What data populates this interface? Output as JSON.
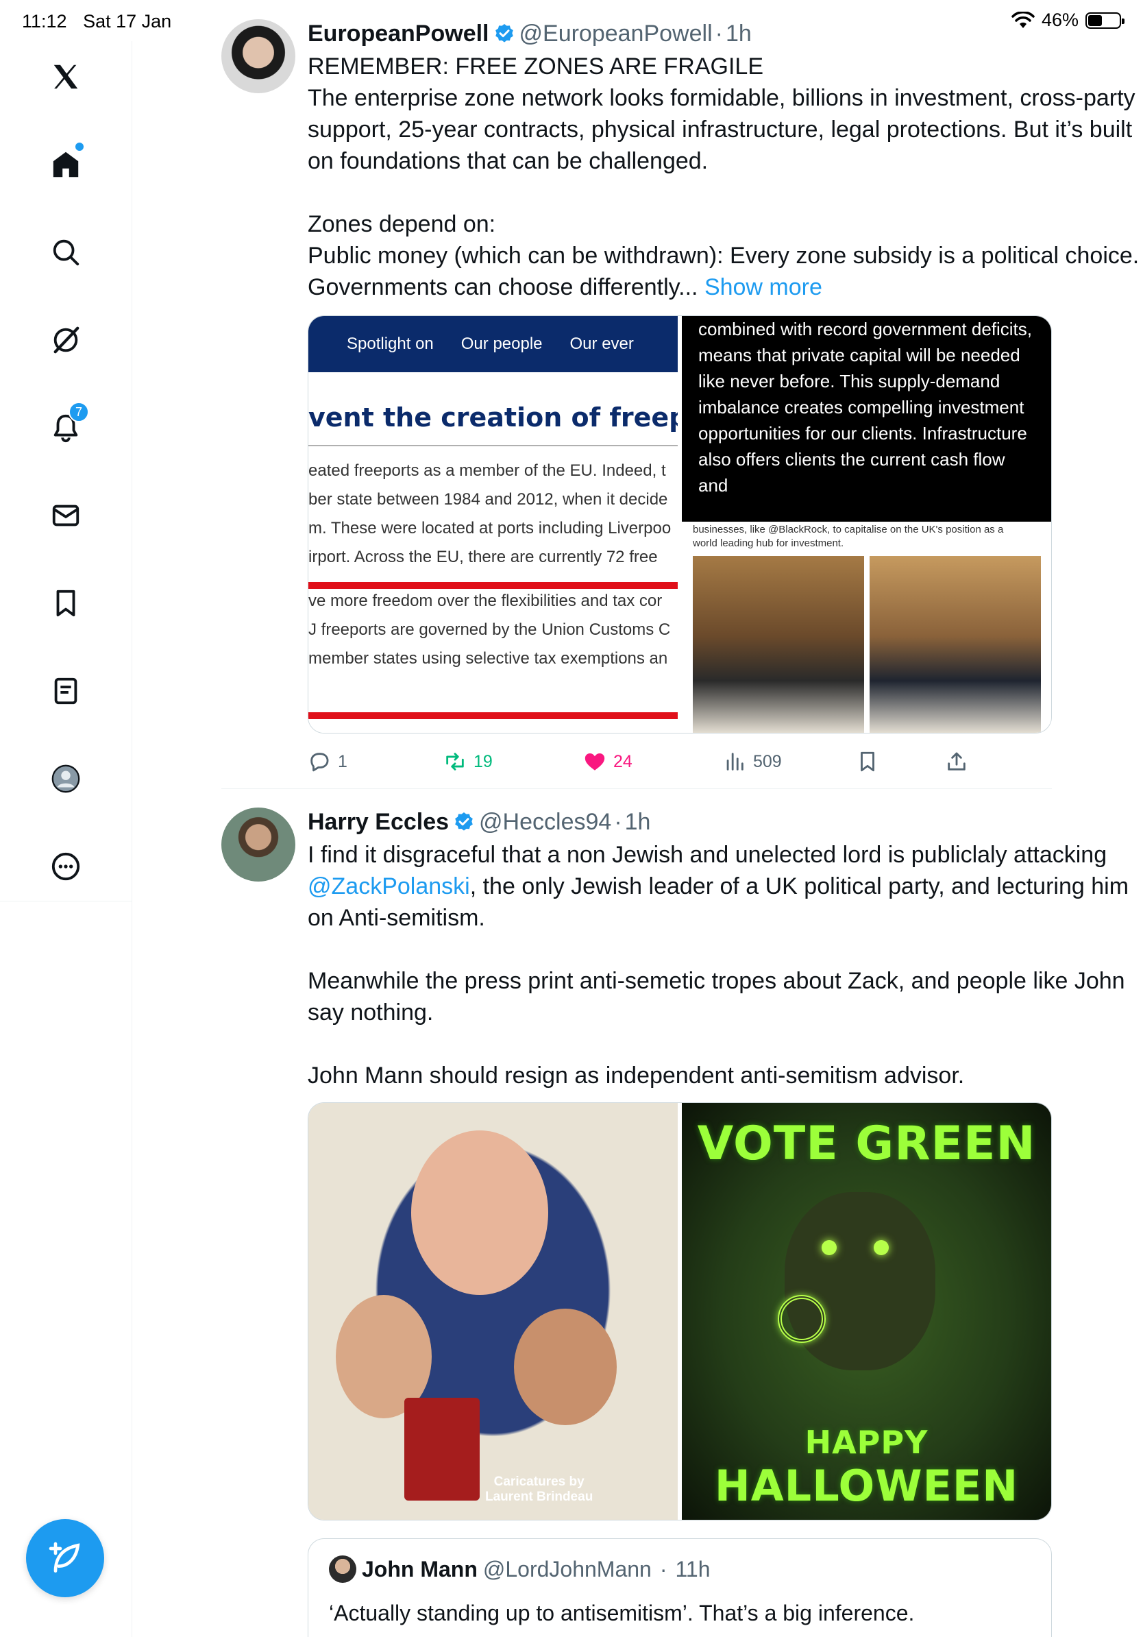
{
  "status_bar": {
    "time": "11:12",
    "date": "Sat 17 Jan",
    "battery_percent": "46%"
  },
  "sidebar": {
    "items": [
      {
        "name": "x-logo-icon"
      },
      {
        "name": "home-icon",
        "active": true
      },
      {
        "name": "search-icon"
      },
      {
        "name": "grok-icon"
      },
      {
        "name": "notifications-icon",
        "badge": "7"
      },
      {
        "name": "messages-icon"
      },
      {
        "name": "bookmarks-icon"
      },
      {
        "name": "lists-icon"
      },
      {
        "name": "profile-icon"
      },
      {
        "name": "more-icon"
      }
    ],
    "compose_icon": "compose-icon"
  },
  "tweets": [
    {
      "author": "EuropeanPowell",
      "handle": "@EuropeanPowell",
      "dot": "·",
      "time": "1h",
      "text_main": "REMEMBER: FREE ZONES ARE FRAGILE\nThe enterprise zone network looks formidable, billions in investment, cross-party support, 25-year contracts, physical infrastructure, legal protections. But it’s built on foundations that can be challenged.\n\nZones depend on:\nPublic money (which can be withdrawn): Every zone subsidy is a political choice. Governments can choose differently...",
      "show_more": "Show more",
      "media": {
        "left": {
          "nav": [
            "Spotlight on",
            "Our people",
            "Our ever"
          ],
          "title": "vent the creation of freeports",
          "lines": [
            "eated freeports as a member of the EU. Indeed, t",
            "ber state between 1984 and 2012, when it decide",
            "m. These were located at ports including Liverpoo",
            "irport. Across the EU, there are currently 72 free",
            "ve more freedom over the flexibilities and tax cor",
            "J freeports are governed by the Union Customs C",
            "member states using selective tax exemptions an"
          ]
        },
        "right": {
          "quote": "combined with record government deficits, means that private capital will be needed like never before. This supply-demand imbalance creates compelling investment opportunities for our clients. Infrastructure also offers clients the current cash flow and",
          "caption_line1": "businesses, like @BlackRock, to capitalise on the UK's position as a",
          "caption_line2": "world leading hub for investment."
        }
      },
      "replies": "1",
      "retweets": "19",
      "likes": "24",
      "views": "509"
    },
    {
      "author": "Harry Eccles",
      "handle": "@Heccles94",
      "dot": "·",
      "time": "1h",
      "text_p1_a": "I find it disgraceful that a non Jewish and unelected lord is publiclaly attacking ",
      "mention": "@ZackPolanski",
      "text_p1_b": ", the only Jewish leader of a UK political party, and lecturing him on Anti-semitism.",
      "text_p2": "Meanwhile the press print anti-semetic tropes about Zack, and people like John say nothing.",
      "text_p3": "John Mann should resign as independent anti-semitism advisor.",
      "media": {
        "left_credit_line1": "Caricatures by",
        "left_credit_line2": "Laurent Brindeau",
        "right_top": "VOTE GREEN",
        "right_bottom_1": "HAPPY",
        "right_bottom_2": "HALLOWEEN"
      },
      "quote": {
        "author": "John Mann",
        "handle": "@LordJohnMann",
        "dot": "·",
        "time": "11h",
        "text": "‘Actually standing up to antisemitism’. That’s a big inference."
      }
    }
  ],
  "colors": {
    "accent": "#1d9bf0",
    "retweet": "#00ba7c",
    "like": "#f91880",
    "muted": "#536471"
  }
}
